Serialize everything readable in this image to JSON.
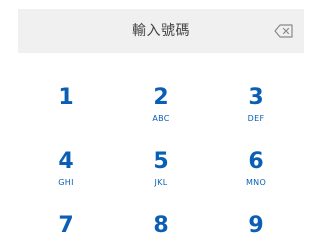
{
  "input": {
    "placeholder": "輸入號碼"
  },
  "keys": [
    {
      "digit": "1",
      "letters": ""
    },
    {
      "digit": "2",
      "letters": "ABC"
    },
    {
      "digit": "3",
      "letters": "DEF"
    },
    {
      "digit": "4",
      "letters": "GHI"
    },
    {
      "digit": "5",
      "letters": "JKL"
    },
    {
      "digit": "6",
      "letters": "MNO"
    },
    {
      "digit": "7",
      "letters": ""
    },
    {
      "digit": "8",
      "letters": ""
    },
    {
      "digit": "9",
      "letters": ""
    }
  ],
  "icons": {
    "backspace": "backspace-icon"
  },
  "colors": {
    "accent": "#0a5fb4",
    "field_background": "#f0f0f0"
  }
}
